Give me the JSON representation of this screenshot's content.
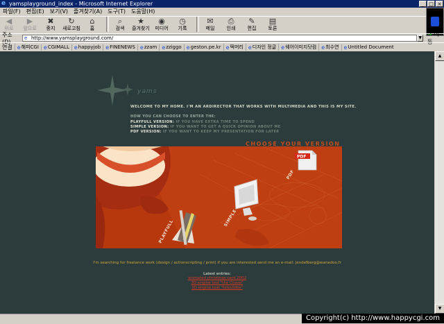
{
  "window": {
    "title": "yamsplayground_index - Microsoft Internet Explorer",
    "controls": [
      "_",
      "□",
      "×"
    ]
  },
  "menu": [
    "파일(F)",
    "편집(E)",
    "보기(V)",
    "즐겨찾기(A)",
    "도구(T)",
    "도움말(H)"
  ],
  "toolbar": {
    "back": "뒤로",
    "forward": "앞으로",
    "stop": "중지",
    "refresh": "새로고침",
    "home": "홈",
    "search": "검색",
    "favorites": "즐겨찾기",
    "media": "미디어",
    "history": "기록",
    "mail": "메일",
    "print": "인쇄",
    "edit": "편집",
    "discuss": "토론"
  },
  "address": {
    "label": "주소(D)",
    "url": "http://www.yamsplayground.com/",
    "go": "이동"
  },
  "links": {
    "label": "연결",
    "items": [
      "해피CGI",
      "CGIMALL",
      "happyjob",
      "FINENEWS",
      "zzam",
      "zziggo",
      "geston.pe.kr",
      "떡머리",
      "디자인 정글",
      "웨어이미지닷컴",
      "최수연",
      "Untitled Document"
    ]
  },
  "site": {
    "logo_text": "yams",
    "welcome": "WELCOME TO MY HOME. I'M AN ARDIRECTOR THAT WORKS WITH MULTIMEDIA AND THIS IS MY SITE.",
    "intro": "HOW YOU CAN CHOOSE TO ENTER THE:",
    "options": [
      {
        "key": "PLAYFULL VERSION:",
        "desc": "IF YOU HAVE EXTRA TIME TO SPEND"
      },
      {
        "key": "SIMPLE VERSION:",
        "desc": "IF YOU WANT TO GET A QUICK OPINION ABOUT ME"
      },
      {
        "key": "PDF VERSION:",
        "desc": "IF YOU WANT TO KEEP MY PRESENTATION FOR LATER"
      }
    ],
    "choose_heading": "CHOOSE YOUR VERSION",
    "panel_labels": {
      "playfull": "PLAYFULL",
      "simple": "SIMPLE",
      "pdf_side": "PDF",
      "pdf_icon": "PDF"
    },
    "freelance": "I'm searching for freelance work (design / actionscripting / print) if you are interested send me an e-mail: jendefberg@wanadoo.fr",
    "latest_label": "Latest entries:",
    "entries": [
      "animated christmas card 2002",
      "3D engine test \"the Chase\"",
      "3D engine test \"fotoslides\""
    ]
  },
  "colors": {
    "page_bg": "#2c3c3c",
    "panel_bg": "#b8380e",
    "accent_orange": "#c24b1a",
    "link_red": "#e0341e",
    "gold": "#d2a637"
  },
  "overlay": {
    "copyright": "Copyright(c) http://www.happycgi.com"
  }
}
